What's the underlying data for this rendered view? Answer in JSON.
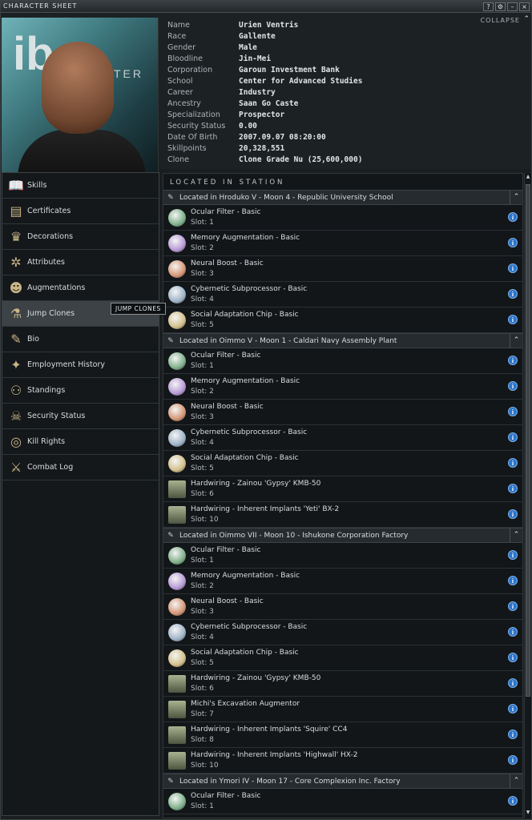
{
  "window": {
    "title": "CHARACTER SHEET",
    "buttons": [
      "?",
      "⚙",
      "–",
      "×"
    ]
  },
  "header": {
    "collapse": "COLLAPSE",
    "collapse_icon": "chevron-up-icon",
    "portrait_logo": "ib",
    "portrait_logo_text": "TER"
  },
  "info": [
    {
      "k": "Name",
      "v": "Urien Ventris"
    },
    {
      "k": "Race",
      "v": "Gallente"
    },
    {
      "k": "Gender",
      "v": "Male"
    },
    {
      "k": "Bloodline",
      "v": "Jin-Mei"
    },
    {
      "k": "Corporation",
      "v": "Garoun Investment Bank"
    },
    {
      "k": "School",
      "v": "Center for Advanced Studies"
    },
    {
      "k": "Career",
      "v": "Industry"
    },
    {
      "k": "Ancestry",
      "v": "Saan Go Caste"
    },
    {
      "k": "Specialization",
      "v": "Prospector"
    },
    {
      "k": "Security Status",
      "v": "0.00"
    },
    {
      "k": "Date Of Birth",
      "v": "2007.09.07 08:20:00"
    },
    {
      "k": "Skillpoints",
      "v": "20,328,551"
    },
    {
      "k": "Clone",
      "v": "Clone Grade Nu (25,600,000)"
    }
  ],
  "nav": [
    {
      "label": "Skills",
      "icon": "book-icon",
      "glyph": "📖"
    },
    {
      "label": "Certificates",
      "icon": "certificate-icon",
      "glyph": "▤"
    },
    {
      "label": "Decorations",
      "icon": "medal-icon",
      "glyph": "♛"
    },
    {
      "label": "Attributes",
      "icon": "atom-icon",
      "glyph": "✲"
    },
    {
      "label": "Augmentations",
      "icon": "head-implant-icon",
      "glyph": "☻"
    },
    {
      "label": "Jump Clones",
      "icon": "clone-icon",
      "glyph": "⚗",
      "active": true
    },
    {
      "label": "Bio",
      "icon": "document-icon",
      "glyph": "✎"
    },
    {
      "label": "Employment History",
      "icon": "stars-icon",
      "glyph": "✦"
    },
    {
      "label": "Standings",
      "icon": "people-icon",
      "glyph": "⚇"
    },
    {
      "label": "Security Status",
      "icon": "skull-icon",
      "glyph": "☠"
    },
    {
      "label": "Kill Rights",
      "icon": "target-icon",
      "glyph": "◎"
    },
    {
      "label": "Combat Log",
      "icon": "crossed-swords-icon",
      "glyph": "⚔"
    }
  ],
  "tooltip": "JUMP CLONES",
  "main": {
    "section": "LOCATED IN STATION",
    "locations": [
      {
        "title": "Located in Hroduko V - Moon 4 - Republic University School",
        "implants": [
          {
            "name": "Ocular Filter - Basic",
            "slot": "Slot: 1",
            "color": "#7fb08a"
          },
          {
            "name": "Memory Augmentation - Basic",
            "slot": "Slot: 2",
            "color": "#b89ad6"
          },
          {
            "name": "Neural Boost - Basic",
            "slot": "Slot: 3",
            "color": "#d59676"
          },
          {
            "name": "Cybernetic Subprocessor - Basic",
            "slot": "Slot: 4",
            "color": "#9fb3c8"
          },
          {
            "name": "Social Adaptation Chip - Basic",
            "slot": "Slot: 5",
            "color": "#d3c08a"
          }
        ]
      },
      {
        "title": "Located in Oimmo V - Moon 1 - Caldari Navy Assembly Plant",
        "implants": [
          {
            "name": "Ocular Filter - Basic",
            "slot": "Slot: 1",
            "color": "#7fb08a"
          },
          {
            "name": "Memory Augmentation - Basic",
            "slot": "Slot: 2",
            "color": "#b89ad6"
          },
          {
            "name": "Neural Boost - Basic",
            "slot": "Slot: 3",
            "color": "#d59676"
          },
          {
            "name": "Cybernetic Subprocessor - Basic",
            "slot": "Slot: 4",
            "color": "#9fb3c8"
          },
          {
            "name": "Social Adaptation Chip - Basic",
            "slot": "Slot: 5",
            "color": "#d3c08a"
          },
          {
            "name": "Hardwiring - Zainou 'Gypsy' KMB-50",
            "slot": "Slot: 6",
            "color": "#8f9a7a",
            "square": true
          },
          {
            "name": "Hardwiring - Inherent Implants 'Yeti' BX-2",
            "slot": "Slot: 10",
            "color": "#8f9a7a",
            "square": true
          }
        ]
      },
      {
        "title": "Located in Oimmo VII - Moon 10 - Ishukone Corporation Factory",
        "implants": [
          {
            "name": "Ocular Filter - Basic",
            "slot": "Slot: 1",
            "color": "#7fb08a"
          },
          {
            "name": "Memory Augmentation - Basic",
            "slot": "Slot: 2",
            "color": "#b89ad6"
          },
          {
            "name": "Neural Boost - Basic",
            "slot": "Slot: 3",
            "color": "#d59676"
          },
          {
            "name": "Cybernetic Subprocessor - Basic",
            "slot": "Slot: 4",
            "color": "#9fb3c8"
          },
          {
            "name": "Social Adaptation Chip - Basic",
            "slot": "Slot: 5",
            "color": "#d3c08a"
          },
          {
            "name": "Hardwiring - Zainou 'Gypsy' KMB-50",
            "slot": "Slot: 6",
            "color": "#8f9a7a",
            "square": true
          },
          {
            "name": "Michi's Excavation Augmentor",
            "slot": "Slot: 7",
            "color": "#8f9a7a",
            "square": true
          },
          {
            "name": "Hardwiring - Inherent Implants 'Squire' CC4",
            "slot": "Slot: 8",
            "color": "#8f9a7a",
            "square": true
          },
          {
            "name": "Hardwiring - Inherent Implants 'Highwall' HX-2",
            "slot": "Slot: 10",
            "color": "#8f9a7a",
            "square": true
          }
        ]
      },
      {
        "title": "Located in Ymori IV - Moon 17 - Core Complexion Inc. Factory",
        "implants": [
          {
            "name": "Ocular Filter - Basic",
            "slot": "Slot: 1",
            "color": "#7fb08a"
          }
        ]
      }
    ]
  }
}
